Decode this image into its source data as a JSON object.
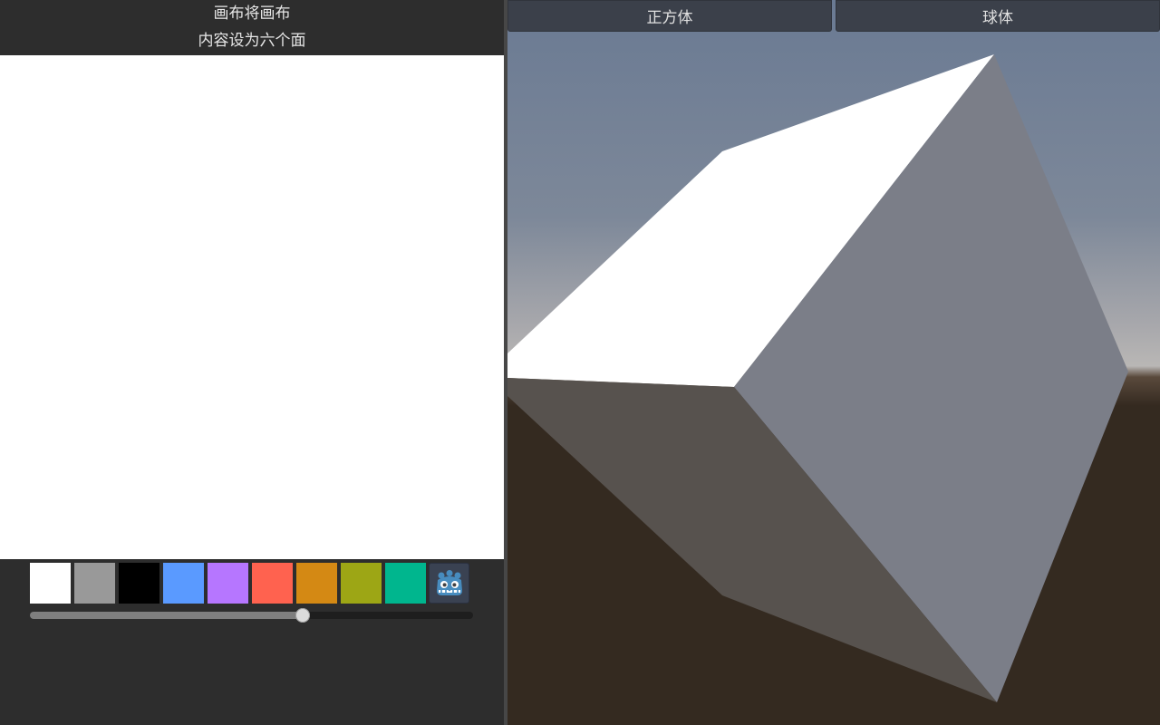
{
  "instructions": {
    "line1": "画布将画布",
    "line2": "内容设为六个面"
  },
  "palette": {
    "swatches": [
      {
        "name": "white",
        "color": "#ffffff"
      },
      {
        "name": "gray",
        "color": "#999999"
      },
      {
        "name": "black",
        "color": "#000000"
      },
      {
        "name": "blue",
        "color": "#5a9aff"
      },
      {
        "name": "purple",
        "color": "#b676ff"
      },
      {
        "name": "red",
        "color": "#ff624f"
      },
      {
        "name": "orange",
        "color": "#d48914"
      },
      {
        "name": "olive",
        "color": "#9da615"
      },
      {
        "name": "teal",
        "color": "#00b68e"
      }
    ],
    "logo_icon": "godot-icon"
  },
  "brush_size_slider": {
    "value_fraction": 0.616
  },
  "viewport": {
    "buttons": {
      "cube": "正方体",
      "sphere": "球体"
    },
    "sky_top_color": "#6a7a93",
    "horizon_color": "#b9b7b5",
    "ground_color": "#342a20"
  }
}
